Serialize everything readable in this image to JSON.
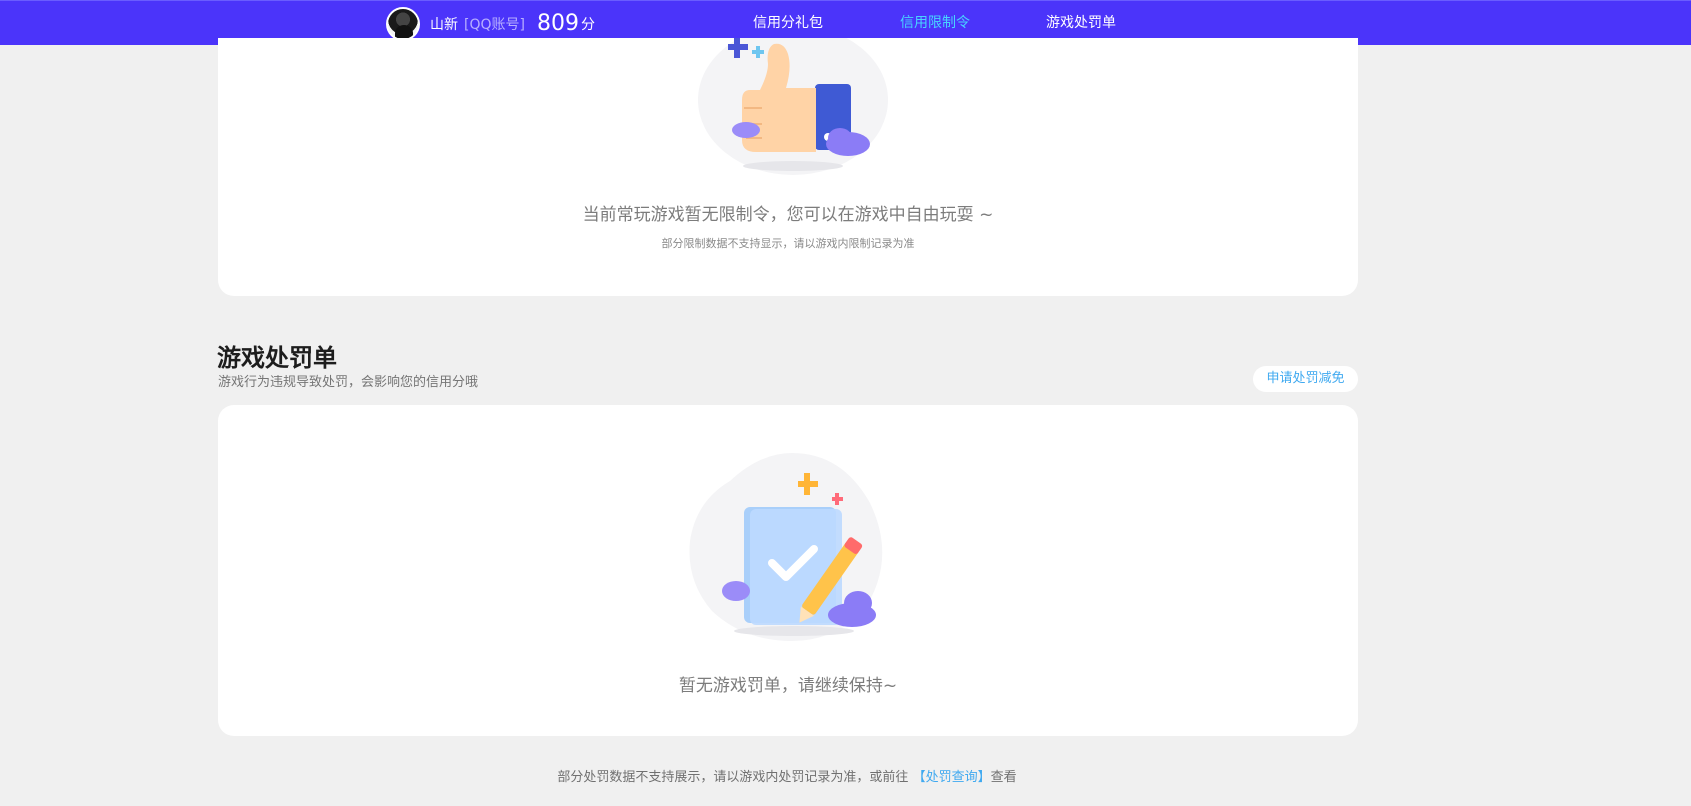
{
  "header": {
    "user_name": "山新",
    "account_type": "[QQ账号]",
    "score": "809",
    "score_unit": "分",
    "tabs": [
      {
        "label": "信用分礼包",
        "active": false
      },
      {
        "label": "信用限制令",
        "active": true
      },
      {
        "label": "游戏处罚单",
        "active": false
      }
    ]
  },
  "restriction": {
    "empty_message": "当前常玩游戏暂无限制令，您可以在游戏中自由玩耍 ~",
    "note": "部分限制数据不支持显示，请以游戏内限制记录为准"
  },
  "penalty": {
    "title": "游戏处罚单",
    "description": "游戏行为违规导致处罚，会影响您的信用分哦",
    "appeal_button": "申请处罚减免",
    "empty_message": "暂无游戏罚单，请继续保持~"
  },
  "footer": {
    "text_before": "部分处罚数据不支持展示，请以游戏内处罚记录为准，或前往",
    "link": "【处罚查询】",
    "text_after": "查看"
  },
  "colors": {
    "nav_background": "#4b34fa",
    "active_tab": "#48d4ff",
    "link": "#3fa9f0"
  }
}
